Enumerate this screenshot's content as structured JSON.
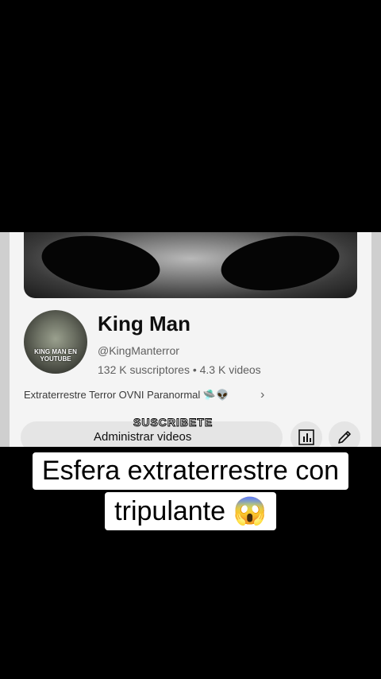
{
  "channel": {
    "name": "King Man",
    "handle": "@KingManterror",
    "stats": "132 K suscriptores • 4.3 K videos",
    "description": "Extraterrestre Terror OVNI Paranormal 🛸👽",
    "avatar_text": "KING MAN EN YOUTUBE"
  },
  "actions": {
    "manage_label": "Administrar videos",
    "overlay_sticker": "SUSCRIBETE"
  },
  "caption": {
    "line1": "Esfera extraterrestre con",
    "line2": "tripulante 😱"
  },
  "icons": {
    "chevron": "chevron-right-icon",
    "analytics": "bar-chart-icon",
    "edit": "pencil-icon"
  },
  "colors": {
    "background": "#000000",
    "panel": "#f4f4f4",
    "button": "#e5e5e5"
  }
}
